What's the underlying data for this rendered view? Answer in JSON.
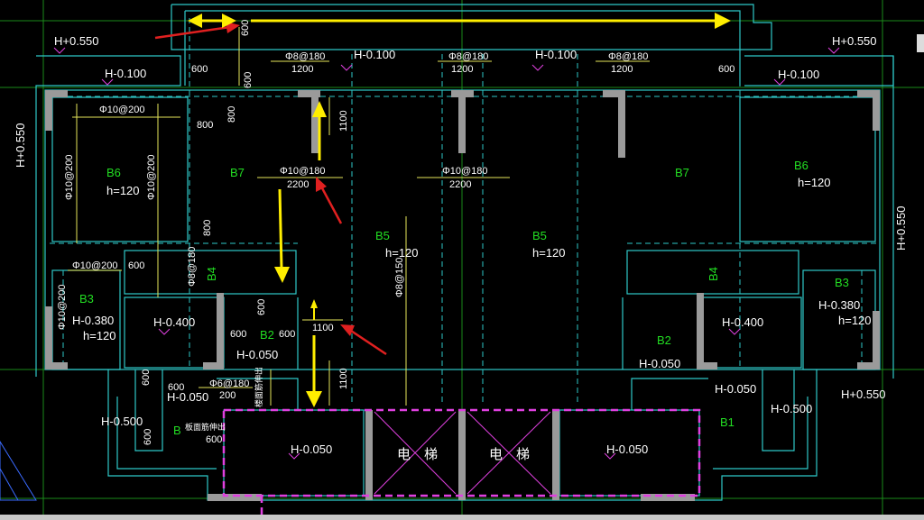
{
  "colors": {
    "bg": "#000000",
    "wall": "#2ec8c8",
    "dim": "#e6e65a",
    "struct": "#9a9a9a",
    "grid": "#1a8a1a",
    "mark": "#e040e0",
    "label": "#22dd22",
    "anno_red": "#e02020",
    "anno_yellow": "#ffee00"
  },
  "levels": {
    "h055_tl": "H+0.550",
    "h055_tr": "H+0.550",
    "h055_left": "H+0.550",
    "h055_right": "H+0.550",
    "h055_br": "H+0.550",
    "h0100_l": "H-0.100",
    "h0100_r": "H-0.100",
    "h0100_c1": "H-0.100",
    "h0100_c2": "H-0.100",
    "h0380_l": "H-0.380",
    "h0380_r": "H-0.380",
    "h0400_l": "H-0.400",
    "h0400_r": "H-0.400",
    "h0050_1": "H-0.050",
    "h0050_2": "H-0.050",
    "h0050_3": "H-0.050",
    "h0050_4": "H-0.050",
    "h0050_5": "H-0.050",
    "h0050_6": "H-0.050",
    "h0500_l": "H-0.500",
    "h0500_r": "H-0.500"
  },
  "slabs": {
    "b6l": "B6",
    "b6r": "B6",
    "b7l": "B7",
    "b7r": "B7",
    "b5l": "B5",
    "b5r": "B5",
    "b4l": "B4",
    "b4r": "B4",
    "b3l": "B3",
    "b3r": "B3",
    "b2l": "B2",
    "b2r": "B2",
    "b1": "B1",
    "b_small": "B"
  },
  "thick": {
    "b6l": "h=120",
    "b6r": "h=120",
    "b5l": "h=120",
    "b5r": "h=120",
    "b3l": "h=120",
    "b3r": "h=120"
  },
  "rebar": {
    "top1": "Φ8@180",
    "top2": "Φ8@180",
    "top3": "Φ8@180",
    "w1": "Φ10@200",
    "v1": "Φ10@200",
    "v2": "Φ10@200",
    "c1": "Φ10@180",
    "c2": "Φ10@180",
    "b4v": "Φ8@180",
    "vert150": "Φ8@150",
    "w3": "Φ10@200",
    "v3": "Φ10@200",
    "s180": "Φ6@180"
  },
  "dims": {
    "d1200a": "1200",
    "d1200b": "1200",
    "d1200c": "1200",
    "d2200a": "2200",
    "d2200b": "2200",
    "d1100a": "1100",
    "d1100b": "1100",
    "d1100c": "1100",
    "d200": "200",
    "d600_1": "600",
    "d600_2": "600",
    "d600_3": "600",
    "d600_4": "600",
    "d600_5": "600",
    "d600_6": "600",
    "d600_7": "600",
    "d600_8": "600",
    "d600_9": "600",
    "d600_10": "600",
    "d600_11": "600",
    "d600_12": "600",
    "d800_1": "800",
    "d800_2": "800",
    "d800_3": "800"
  },
  "notes": {
    "small1": "板面筋伸出",
    "small2": "楼面筋伸出"
  },
  "rooms": {
    "elev1a": "电",
    "elev1b": "梯",
    "elev2a": "电",
    "elev2b": "梯"
  }
}
